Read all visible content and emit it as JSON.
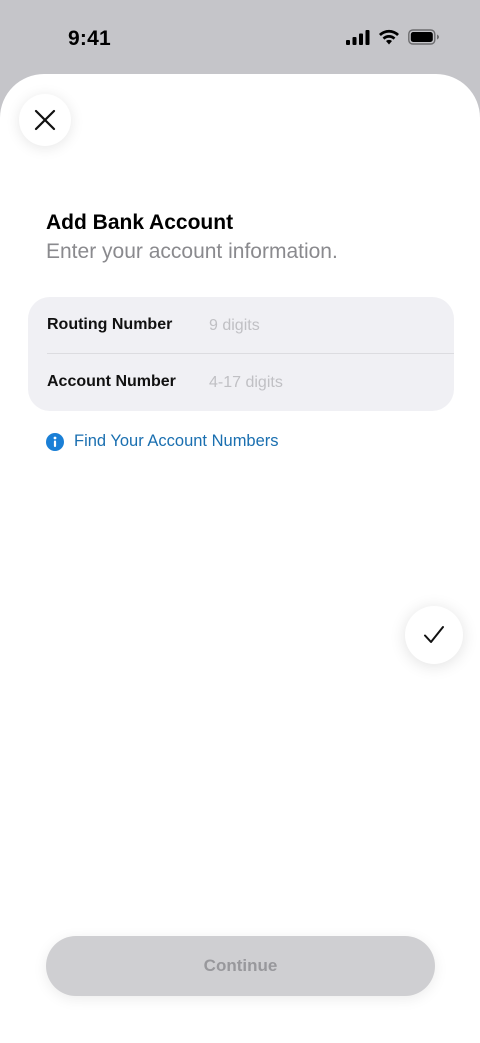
{
  "status_bar": {
    "time": "9:41",
    "icons": [
      "cellular-signal-icon",
      "wifi-icon",
      "battery-icon"
    ]
  },
  "sheet": {
    "title": "Add Bank Account",
    "subtitle": "Enter your account information.",
    "fields": [
      {
        "label": "Routing Number",
        "value": "",
        "placeholder": "9 digits"
      },
      {
        "label": "Account Number",
        "value": "",
        "placeholder": "4-17 digits"
      }
    ],
    "help_link": {
      "label": "Find Your Account Numbers",
      "icon": "info-icon"
    },
    "continue_label": "Continue",
    "continue_enabled": false
  },
  "colors": {
    "link": "#1a6fb0",
    "info_icon": "#1a7fd6",
    "disabled_button": "#cfcfd2",
    "disabled_text": "#98989c",
    "backdrop": "#c5c5c9"
  }
}
